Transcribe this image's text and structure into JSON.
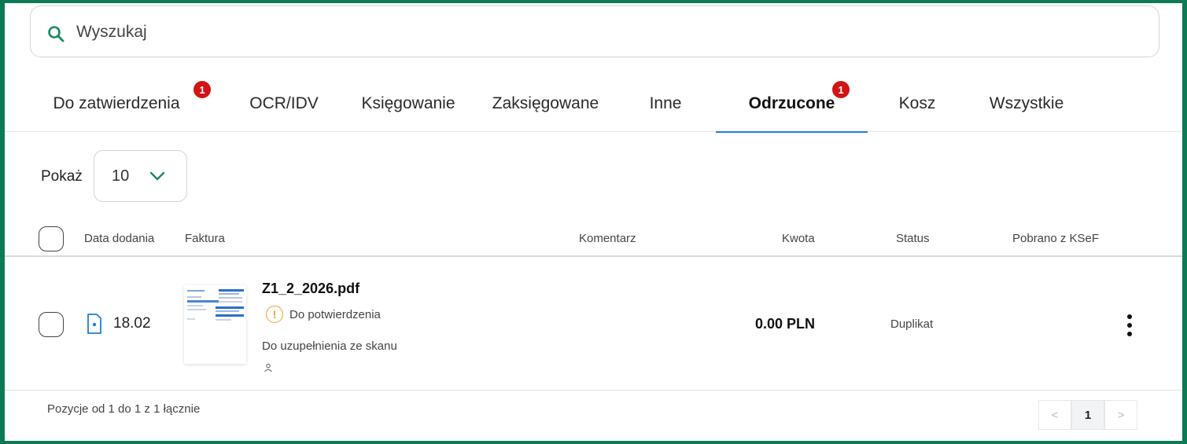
{
  "search": {
    "placeholder": "Wyszukaj"
  },
  "tabs": [
    {
      "label": "Do zatwierdzenia",
      "badge": "1"
    },
    {
      "label": "OCR/IDV"
    },
    {
      "label": "Księgowanie"
    },
    {
      "label": "Zaksięgowane"
    },
    {
      "label": "Inne"
    },
    {
      "label": "Odrzucone",
      "badge": "1",
      "active": true
    },
    {
      "label": "Kosz"
    },
    {
      "label": "Wszystkie"
    }
  ],
  "show": {
    "label": "Pokaż",
    "value": "10"
  },
  "table": {
    "columns": [
      "Data dodania",
      "Faktura",
      "Komentarz",
      "Kwota",
      "Status",
      "Pobrano z KSeF"
    ],
    "rows": [
      {
        "date": "18.02",
        "filename": "Z1_2_2026.pdf",
        "pending": "Do potwierdzenia",
        "pending_icon": "warning-icon",
        "note": "Do uzupełnienia ze skanu",
        "amount": "0.00 PLN",
        "status": "Duplikat"
      }
    ]
  },
  "footer": {
    "summary": "Pozycje od 1 do 1 z 1 łącznie"
  },
  "pagination": {
    "prev": "<",
    "current": "1",
    "next": ">"
  },
  "colors": {
    "accent": "#1f7fd6",
    "brand": "#0b7a55",
    "badge": "#d21414",
    "warning": "#f0a020"
  }
}
